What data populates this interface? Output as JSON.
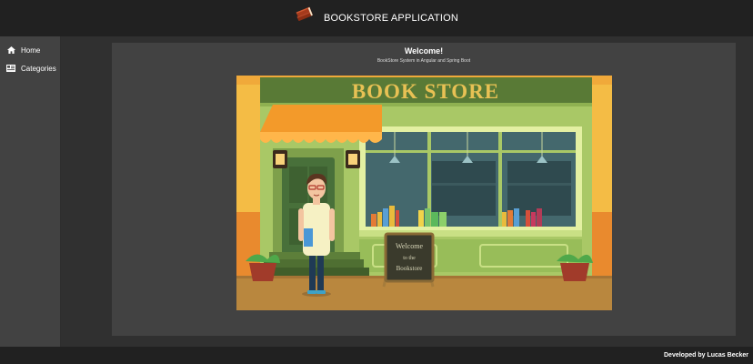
{
  "app": {
    "title": "BOOKSTORE APPLICATION",
    "logo_icon": "book-stack-icon"
  },
  "sidebar": {
    "items": [
      {
        "label": "Home",
        "icon": "home-icon"
      },
      {
        "label": "Categories",
        "icon": "category-icon"
      }
    ]
  },
  "main": {
    "title": "Welcome!",
    "subtitle": "BookStore System in Angular and Spring Boot",
    "illustration": {
      "store_sign": "BOOK STORE",
      "board_text": [
        "Welcome",
        "to the",
        "Bookstore"
      ]
    }
  },
  "footer": {
    "credit": "Developed by Lucas Becker"
  },
  "colors": {
    "topbar": "#212121",
    "sidebar": "#424242",
    "background": "#303030",
    "card": "#424242",
    "sign_text": "#e8c154"
  }
}
